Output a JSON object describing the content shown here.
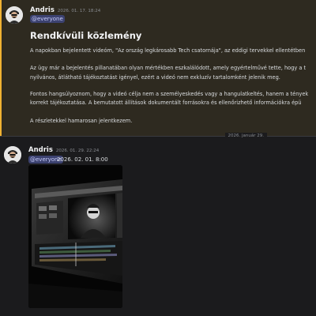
{
  "messages": [
    {
      "author": "Andris",
      "timestamp": "2026. 01. 17. 18:24",
      "mention": "@everyone",
      "heading": "Rendkívüli közlemény",
      "paragraphs": [
        "A napokban bejelentett videóm, \"Az ország legkárosabb Tech csatornája\", az eddigi tervekkel ellentétben",
        "Az ügy már a bejelentés pillanatában olyan mértékben eszkalálódott, amely egyértelművé tette, hogy a t",
        "nyilvános, átlátható tájékoztatást igényel, ezért a videó nem exkluzív tartalomként jelenik meg.",
        "Fontos hangsúlyoznom, hogy a videó célja nem a személyeskedés vagy a hangulatkeltés, hanem a tények",
        "korrekt tájékoztatása. A bemutatott állítások dokumentált forrásokra és ellenőrizhető információkra épü",
        "A részletekkel hamarosan jelentkezem."
      ]
    },
    {
      "author": "Andris",
      "timestamp": "2026. 01. 29. 22:24",
      "mention": "@everyone",
      "content": "2026. 02. 01. 8:00",
      "attachment": "video-editor-screenshot"
    }
  ],
  "date_divider": "2026. január 29.",
  "colors": {
    "background": "#1b1b1d",
    "highlight_background": "#2e2a20",
    "highlight_bar": "#f0b232",
    "mention_bg": "#3c4270",
    "mention_text": "#c9cdfb"
  }
}
